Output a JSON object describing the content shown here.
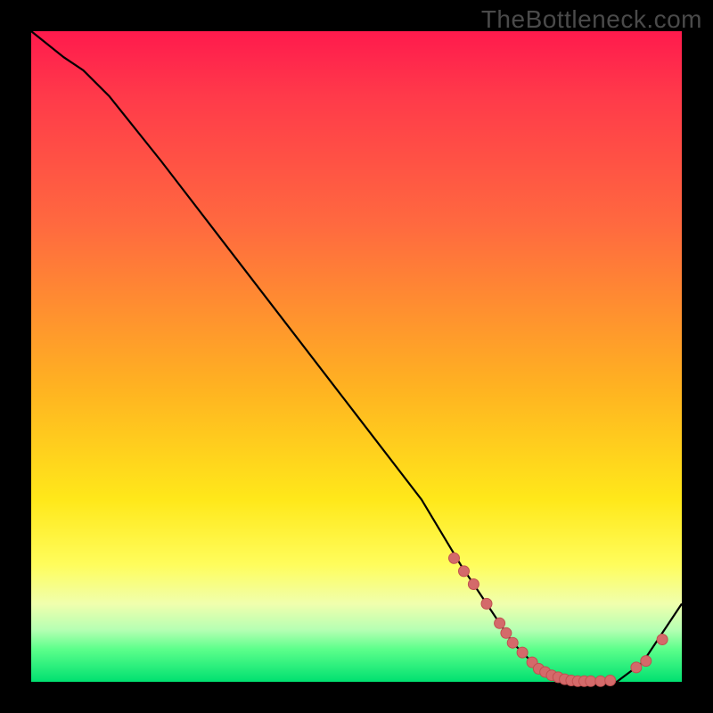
{
  "watermark": "TheBottleneck.com",
  "colors": {
    "frame_bg": "#000000",
    "curve_stroke": "#000000",
    "dot_fill": "#d46a6a",
    "dot_stroke": "#c05050"
  },
  "chart_data": {
    "type": "line",
    "title": "",
    "xlabel": "",
    "ylabel": "",
    "xlim": [
      0,
      100
    ],
    "ylim": [
      0,
      100
    ],
    "series": [
      {
        "name": "bottleneck-curve",
        "x": [
          0,
          5,
          8,
          12,
          20,
          30,
          40,
          50,
          60,
          66,
          70,
          74,
          78,
          82,
          86,
          90,
          94,
          100
        ],
        "y": [
          100,
          96,
          94,
          90,
          80,
          67,
          54,
          41,
          28,
          18,
          12,
          6,
          2,
          0,
          0,
          0,
          3,
          12
        ]
      }
    ],
    "dots": {
      "name": "highlight-points",
      "x": [
        65,
        66.5,
        68,
        70,
        72,
        73,
        74,
        75.5,
        77,
        78,
        79,
        80,
        81,
        82,
        83,
        84,
        85,
        86,
        87.5,
        89,
        93,
        94.5,
        97
      ],
      "y": [
        19,
        17,
        15,
        12,
        9,
        7.5,
        6,
        4.5,
        3,
        2,
        1.5,
        1,
        0.7,
        0.4,
        0.2,
        0.1,
        0.1,
        0.1,
        0.1,
        0.2,
        2.2,
        3.2,
        6.5
      ]
    }
  }
}
